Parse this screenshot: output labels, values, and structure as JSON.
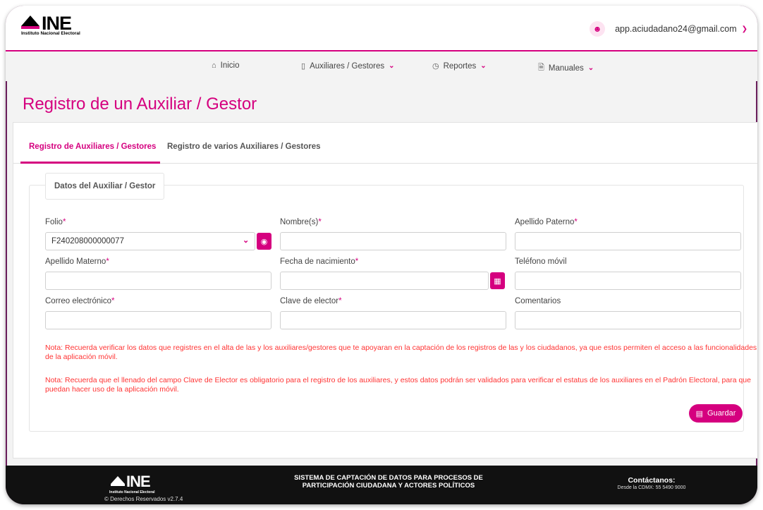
{
  "header": {
    "logo_text": "INE",
    "logo_subtitle": "Instituto Nacional Electoral",
    "user_email": "app.aciudadano24@gmail.com"
  },
  "nav": {
    "items": [
      {
        "label": "Inicio",
        "icon": "home-icon"
      },
      {
        "label": "Auxiliares / Gestores",
        "icon": "phone-icon",
        "dropdown": true
      },
      {
        "label": "Reportes",
        "icon": "clock-icon",
        "dropdown": true
      },
      {
        "label": "Manuales",
        "icon": "document-icon",
        "dropdown": true
      }
    ]
  },
  "page_title": "Registro de un Auxiliar / Gestor",
  "tabs": [
    {
      "label": "Registro de Auxiliares / Gestores",
      "active": true
    },
    {
      "label": "Registro de varios Auxiliares / Gestores",
      "active": false
    }
  ],
  "form": {
    "legend": "Datos del Auxiliar / Gestor",
    "fields": {
      "folio": {
        "label": "Folio",
        "required": "*",
        "value": "F240208000000077"
      },
      "nombre": {
        "label": "Nombre(s)",
        "required": "*",
        "value": ""
      },
      "apellido_paterno": {
        "label": "Apellido Paterno",
        "required": "*",
        "value": ""
      },
      "apellido_materno": {
        "label": "Apellido Materno",
        "required": "*",
        "value": ""
      },
      "fecha_nacimiento": {
        "label": "Fecha de nacimiento",
        "required": "*",
        "value": ""
      },
      "telefono": {
        "label": "Teléfono móvil",
        "value": ""
      },
      "correo": {
        "label": "Correo electrónico",
        "required": "*",
        "value": ""
      },
      "clave_elector": {
        "label": "Clave de elector",
        "required": "*",
        "value": ""
      },
      "comentarios": {
        "label": "Comentarios",
        "value": ""
      }
    },
    "notes": [
      "Nota: Recuerda verificar los datos que registres en el alta de las y los auxiliares/gestores que te apoyaran en la captación de los registros de las y los ciudadanos, ya que estos permiten el acceso a las funcionalidades de la aplicación móvil.",
      "Nota: Recuerda que el llenado del campo Clave de Elector es obligatorio para el registro de los auxiliares, y estos datos podrán ser validados para verificar el estatus de los auxiliares en el Padrón Electoral, para que puedan hacer uso de la aplicación móvil."
    ],
    "save_label": "Guardar"
  },
  "footer": {
    "logo_text": "INE",
    "logo_subtitle": "Instituto Nacional Electoral",
    "copyright": "© Derechos Reservados v2.7.4",
    "system_line1": "SISTEMA DE CAPTACIÓN DE DATOS PARA PROCESOS DE",
    "system_line2": "PARTICIPACIÓN CIUDADANA Y ACTORES POLÍTICOS",
    "contact_title": "Contáctanos:",
    "contact_phone": "Desde la CDMX: 55 5490 9000"
  },
  "colors": {
    "accent": "#d5007f",
    "note": "#ff3333",
    "footer_bg": "#111111"
  }
}
